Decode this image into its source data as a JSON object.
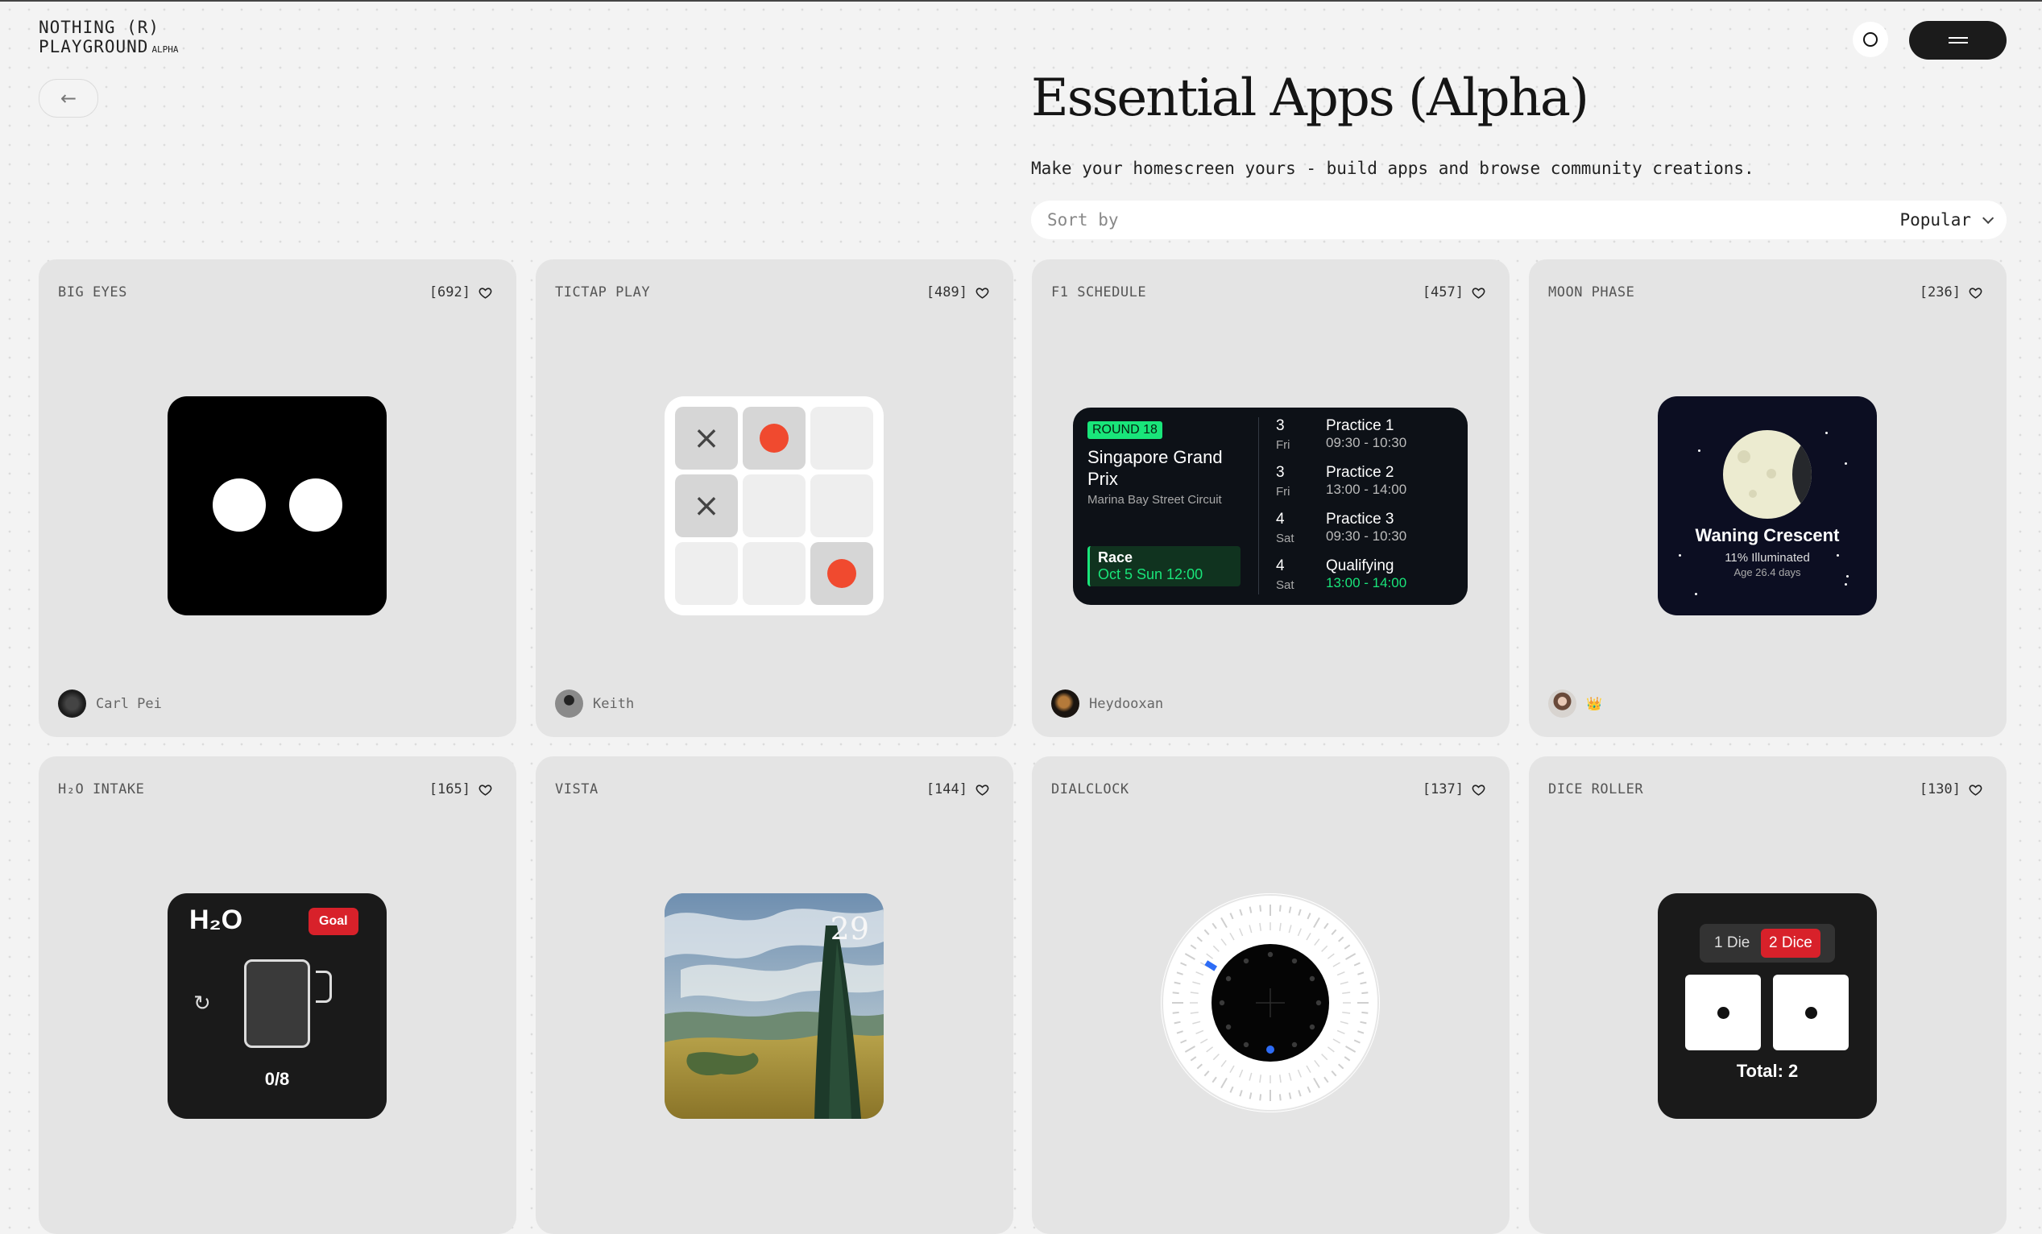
{
  "header": {
    "logo_line1": "NOTHING (R)",
    "logo_line2": "PLAYGROUND",
    "logo_badge": "ALPHA",
    "theme_icon": "circle-icon",
    "menu_icon": "menu-icon",
    "back_icon": "arrow-left-icon",
    "back_glyph": "←"
  },
  "page": {
    "title": "Essential Apps (Alpha)",
    "subtitle": "Make your homescreen yours - build apps and browse community creations.",
    "sort_label": "Sort by",
    "sort_value": "Popular"
  },
  "colors": {
    "accent_red": "#f04a2f",
    "goal_red": "#d8212a",
    "f1_green": "#19e57a",
    "dial_blue": "#2d6cf6"
  },
  "cards": [
    {
      "title": "BIG EYES",
      "likes": "[692]",
      "author": "Carl Pei"
    },
    {
      "title": "TICTAP PLAY",
      "likes": "[489]",
      "author": "Keith"
    },
    {
      "title": "F1 SCHEDULE",
      "likes": "[457]",
      "author": "Heydooxan"
    },
    {
      "title": "MOON PHASE",
      "likes": "[236]",
      "author": "",
      "author_badge": "👑"
    },
    {
      "title": "H₂O INTAKE",
      "likes": "[165]"
    },
    {
      "title": "VISTA",
      "likes": "[144]"
    },
    {
      "title": "DIALCLOCK",
      "likes": "[137]"
    },
    {
      "title": "DICE ROLLER",
      "likes": "[130]"
    }
  ],
  "tictap": {
    "board": [
      "x",
      "o",
      "",
      "x",
      "",
      "",
      "",
      "",
      "o"
    ],
    "x_glyph": "×"
  },
  "f1": {
    "badge": "ROUND 18",
    "grand_prix": "Singapore Grand Prix",
    "circuit": "Marina Bay Street Circuit",
    "race_label": "Race",
    "race_date": "Oct 5 Sun 12:00",
    "sessions": [
      {
        "day": "3",
        "dow": "Fri",
        "name": "Practice 1",
        "time": "09:30 - 10:30"
      },
      {
        "day": "3",
        "dow": "Fri",
        "name": "Practice 2",
        "time": "13:00 - 14:00"
      },
      {
        "day": "4",
        "dow": "Sat",
        "name": "Practice 3",
        "time": "09:30 - 10:30"
      },
      {
        "day": "4",
        "dow": "Sat",
        "name": "Qualifying",
        "time": "13:00 - 14:00"
      }
    ]
  },
  "moon": {
    "phase": "Waning Crescent",
    "illumination": "11% Illuminated",
    "age": "Age 26.4 days"
  },
  "h2o": {
    "title": "H₂O",
    "goal_label": "Goal",
    "reset_glyph": "↻",
    "count": "0/8"
  },
  "vista": {
    "number": "29"
  },
  "dice": {
    "option_one": "1 Die",
    "option_two": "2 Dice",
    "selected": "2 Dice",
    "total": "Total: 2"
  }
}
